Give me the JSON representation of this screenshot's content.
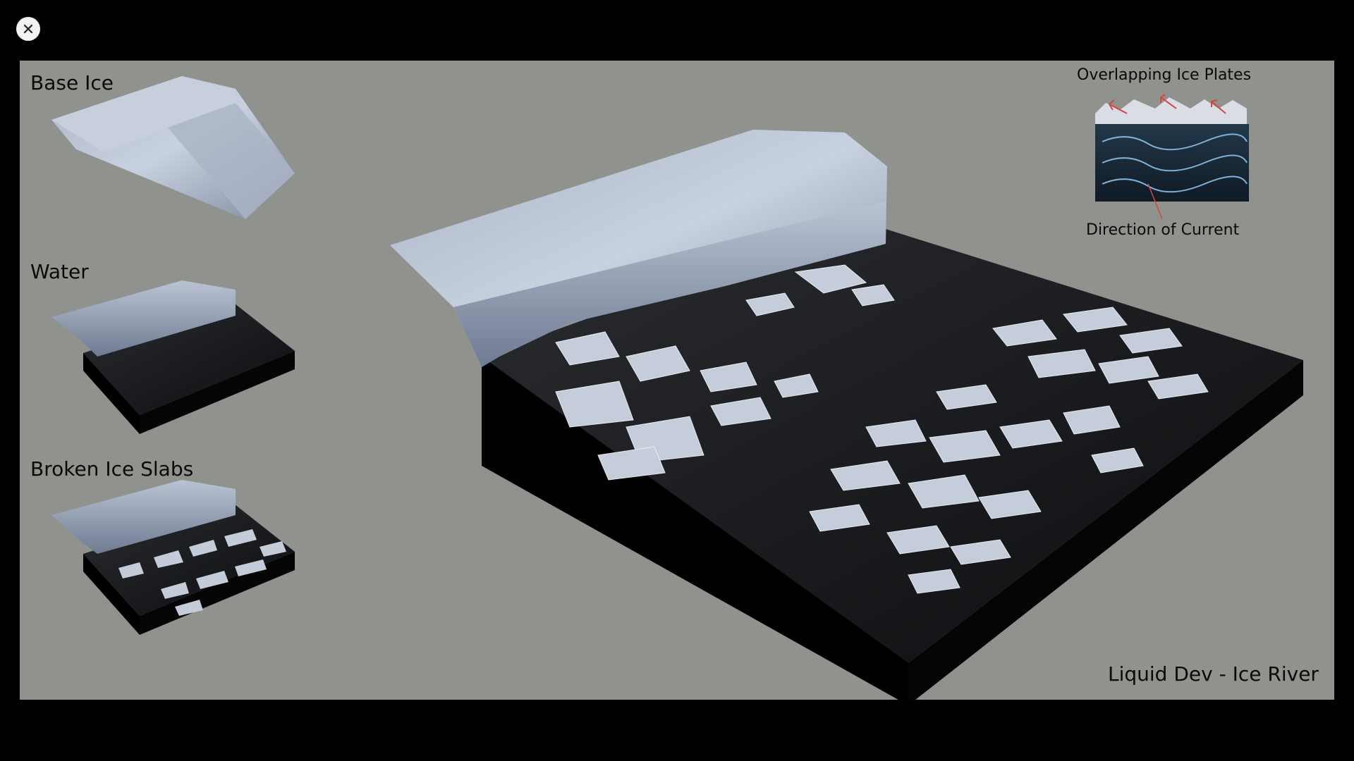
{
  "viewer": {
    "close_icon": "close-icon"
  },
  "slide": {
    "labels": {
      "base_ice": "Base Ice",
      "water": "Water",
      "broken_ice_slabs": "Broken Ice Slabs",
      "overlapping_ice_plates": "Overlapping Ice Plates",
      "direction_of_current": "Direction of Current",
      "credit": "Liquid Dev - Ice River"
    },
    "colors": {
      "background": "#8f928d",
      "ice": "#c9d2e0",
      "water": "#151618",
      "arrow_red": "#d4463f",
      "arrow_blue": "#7fb0d8"
    }
  }
}
